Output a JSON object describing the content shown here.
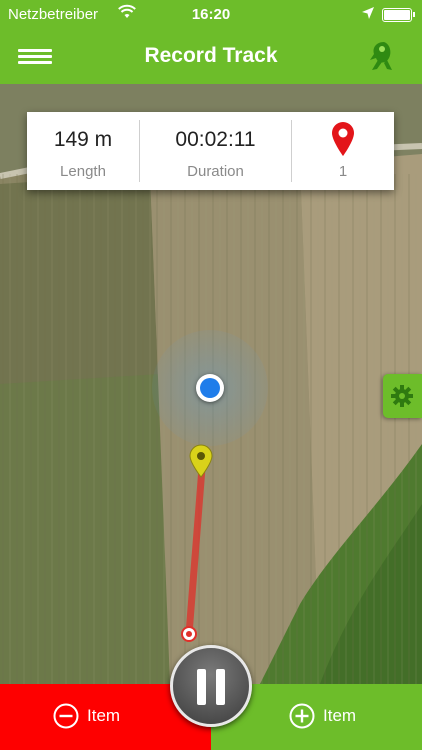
{
  "status_bar": {
    "carrier": "Netzbetreiber",
    "time": "16:20",
    "wifi_icon": "wifi-icon",
    "location_icon": "location-arrow-icon",
    "battery_icon": "battery-icon"
  },
  "nav": {
    "title": "Record Track",
    "menu_icon": "hamburger-menu-icon",
    "logo_icon": "app-logo-icon"
  },
  "stats": {
    "length_value": "149 m",
    "length_label": "Length",
    "duration_value": "00:02:11",
    "duration_label": "Duration",
    "waypoints_count": "1",
    "waypoints_icon": "map-pin-icon"
  },
  "map": {
    "current_position_icon": "current-location-dot",
    "waypoint_icon": "yellow-map-pin-icon",
    "start_icon": "track-start-marker",
    "track_color": "#e0302a"
  },
  "controls": {
    "settings_icon": "gear-icon",
    "remove_item_label": "Item",
    "add_item_label": "Item",
    "pause_icon": "pause-icon"
  },
  "colors": {
    "brand_green": "#6dbd2a",
    "remove_red": "#fe0000",
    "marker_blue": "#1f7dea"
  }
}
